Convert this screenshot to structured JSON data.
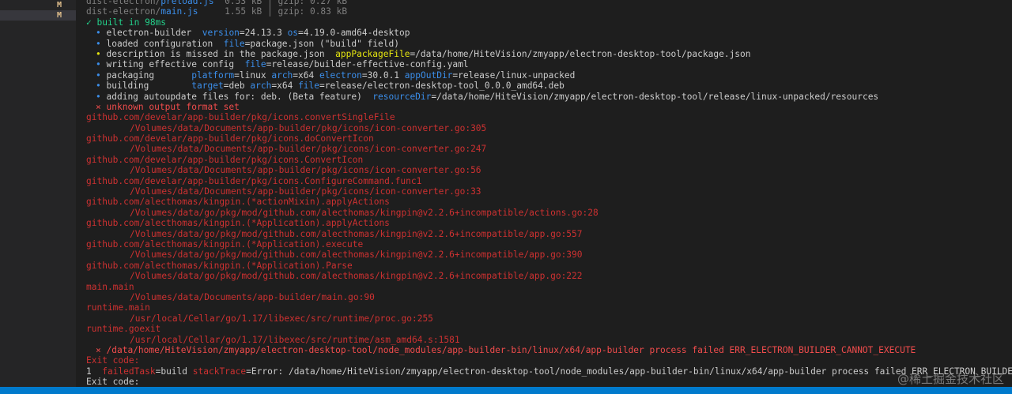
{
  "sidebar": {
    "badges": [
      "M",
      "M"
    ]
  },
  "terminal": {
    "build_rows": [
      {
        "dir": "dist-electron/",
        "file": "preload.js",
        "size": "0.53 kB",
        "sep": "│",
        "gzip": "gzip: 0.27 kB"
      },
      {
        "dir": "dist-electron/",
        "file": "main.js",
        "size": "1.55 kB",
        "sep": "│",
        "gzip": "gzip: 0.83 kB"
      }
    ],
    "built_in": "✓ built in 98ms",
    "builder": {
      "bullet": "•",
      "line1_text": "electron-builder",
      "line1_k1": "version",
      "line1_v1": "=24.13.3",
      "line1_k2": "os",
      "line1_v2": "=4.19.0-amd64-desktop",
      "line2_text": "loaded configuration",
      "line2_k1": "file",
      "line2_v1": "=package.json (\"build\" field)",
      "line3_text": "description is missed in the package.json",
      "line3_k1": "appPackageFile",
      "line3_v1": "=/data/home/HiteVision/zmyapp/electron-desktop-tool/package.json",
      "line4_text": "writing effective config",
      "line4_k1": "file",
      "line4_v1": "=release/builder-effective-config.yaml",
      "line5_text": "packaging",
      "line5_k1": "platform",
      "line5_v1": "=linux",
      "line5_k2": "arch",
      "line5_v2": "=x64",
      "line5_k3": "electron",
      "line5_v3": "=30.0.1",
      "line5_k4": "appOutDir",
      "line5_v4": "=release/linux-unpacked",
      "line6_text": "building",
      "line6_k1": "target",
      "line6_v1": "=deb",
      "line6_k2": "arch",
      "line6_v2": "=x64",
      "line6_k3": "file",
      "line6_v3": "=release/electron-desktop-tool_0.0.0_amd64.deb",
      "line7_text": "adding autoupdate files for: deb. (Beta feature)",
      "line7_k1": "resourceDir",
      "line7_v1": "=/data/home/HiteVision/zmyapp/electron-desktop-tool/release/linux-unpacked/resources",
      "error_mark": "⨯",
      "error_text": "unknown output format set"
    },
    "stack": [
      {
        "func": "github.com/develar/app-builder/pkg/icons.convertSingleFile",
        "path": "/Volumes/data/Documents/app-builder/pkg/icons/icon-converter.go:305"
      },
      {
        "func": "github.com/develar/app-builder/pkg/icons.doConvertIcon",
        "path": "/Volumes/data/Documents/app-builder/pkg/icons/icon-converter.go:247"
      },
      {
        "func": "github.com/develar/app-builder/pkg/icons.ConvertIcon",
        "path": "/Volumes/data/Documents/app-builder/pkg/icons/icon-converter.go:56"
      },
      {
        "func": "github.com/develar/app-builder/pkg/icons.ConfigureCommand.func1",
        "path": "/Volumes/data/Documents/app-builder/pkg/icons/icon-converter.go:33"
      },
      {
        "func": "github.com/alecthomas/kingpin.(*actionMixin).applyActions",
        "path": "/Volumes/data/go/pkg/mod/github.com/alecthomas/kingpin@v2.2.6+incompatible/actions.go:28"
      },
      {
        "func": "github.com/alecthomas/kingpin.(*Application).applyActions",
        "path": "/Volumes/data/go/pkg/mod/github.com/alecthomas/kingpin@v2.2.6+incompatible/app.go:557"
      },
      {
        "func": "github.com/alecthomas/kingpin.(*Application).execute",
        "path": "/Volumes/data/go/pkg/mod/github.com/alecthomas/kingpin@v2.2.6+incompatible/app.go:390"
      },
      {
        "func": "github.com/alecthomas/kingpin.(*Application).Parse",
        "path": "/Volumes/data/go/pkg/mod/github.com/alecthomas/kingpin@v2.2.6+incompatible/app.go:222"
      },
      {
        "func": "main.main",
        "path": "/Volumes/data/Documents/app-builder/main.go:90"
      },
      {
        "func": "runtime.main",
        "path": "/usr/local/Cellar/go/1.17/libexec/src/runtime/proc.go:255"
      },
      {
        "func": "runtime.goexit",
        "path": "/usr/local/Cellar/go/1.17/libexec/src/runtime/asm_amd64.s:1581"
      }
    ],
    "failure": {
      "mark": "⨯",
      "text": "/data/home/HiteVision/zmyapp/electron-desktop-tool/node_modules/app-builder-bin/linux/x64/app-builder process failed ERR_ELECTRON_BUILDER_CANNOT_EXECUTE",
      "exit_code_1": "Exit code:",
      "exit_num": "1",
      "k1": "failedTask",
      "v1": "=build",
      "k2": "stackTrace",
      "v2": "=Error: /data/home/HiteVision/zmyapp/electron-desktop-tool/node_modules/app-builder-bin/linux/x64/app-builder process failed ERR_ELECTRON_BUILDER_CANNOT_EXECUTE",
      "exit_code_2": "Exit code:"
    }
  },
  "watermark": "@稀土掘金技术社区",
  "colors": {
    "background": "#1e1e1e",
    "sidebar": "#252526",
    "statusbar": "#007acc",
    "key_blue": "#3b8eea",
    "success_green": "#23d18b",
    "warn_yellow": "#e5e510",
    "error_red": "#f14c4c",
    "stack_red": "#cd3131"
  }
}
